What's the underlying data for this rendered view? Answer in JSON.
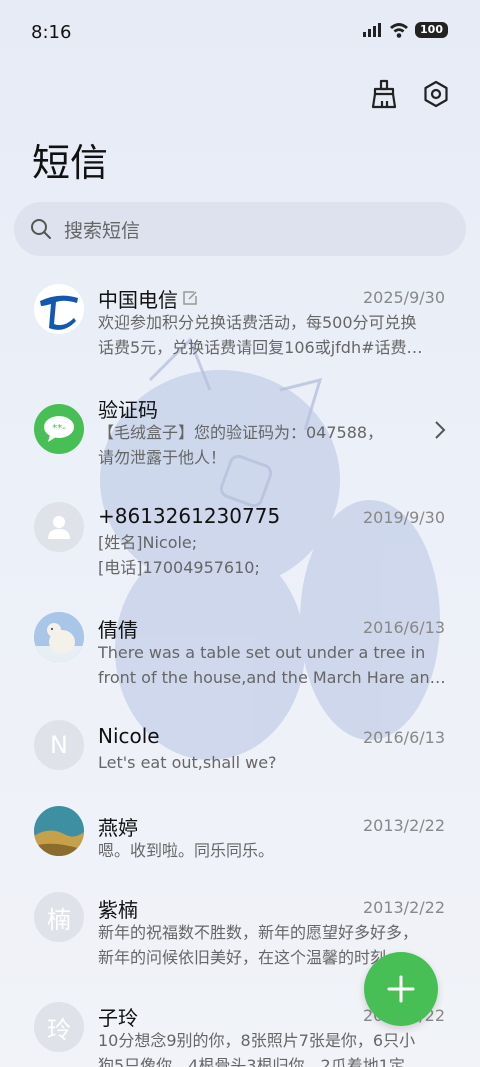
{
  "status": {
    "time": "8:16",
    "battery": "100"
  },
  "header": {
    "title": "短信"
  },
  "search": {
    "placeholder": "搜索短信"
  },
  "conversations": [
    {
      "name": "中国电信",
      "date": "2025/9/30",
      "line1": "欢迎参加积分兑换话费活动，每500分可兑换",
      "line2": "话费5元，兑换话费请回复106或jfdh#话费…"
    },
    {
      "name": "验证码",
      "date": "",
      "line1": "【毛绒盒子】您的验证码为：047588，",
      "line2": "请勿泄露于他人！"
    },
    {
      "name": "+8613261230775",
      "date": "2019/9/30",
      "line1": "[姓名]Nicole;",
      "line2": "[电话]17004957610;"
    },
    {
      "name": "倩倩",
      "date": "2016/6/13",
      "line1": "There was a table set out under a tree in",
      "line2": "front of the house,and the March Hare an…"
    },
    {
      "name": "Nicole",
      "date": "2016/6/13",
      "line1": "Let's eat out,shall we?",
      "line2": "",
      "avatar_letter": "N"
    },
    {
      "name": "燕婷",
      "date": "2013/2/22",
      "line1": "嗯。收到啦。同乐同乐。",
      "line2": ""
    },
    {
      "name": "紫楠",
      "date": "2013/2/22",
      "line1": "新年的祝福数不胜数，新年的愿望好多好多，",
      "line2": "新年的问候依旧美好，在这个温馨的时刻…",
      "avatar_letter": "楠"
    },
    {
      "name": "子玲",
      "date": "2013/2/22",
      "line1": "10分想念9别的你，8张照片7张是你，6只小",
      "line2": "狗5只像你，4根骨头3根归你，2爪着地1定…",
      "avatar_letter": "玲"
    }
  ],
  "colors": {
    "accent": "#48bf55",
    "telecom_blue": "#1358b0"
  }
}
